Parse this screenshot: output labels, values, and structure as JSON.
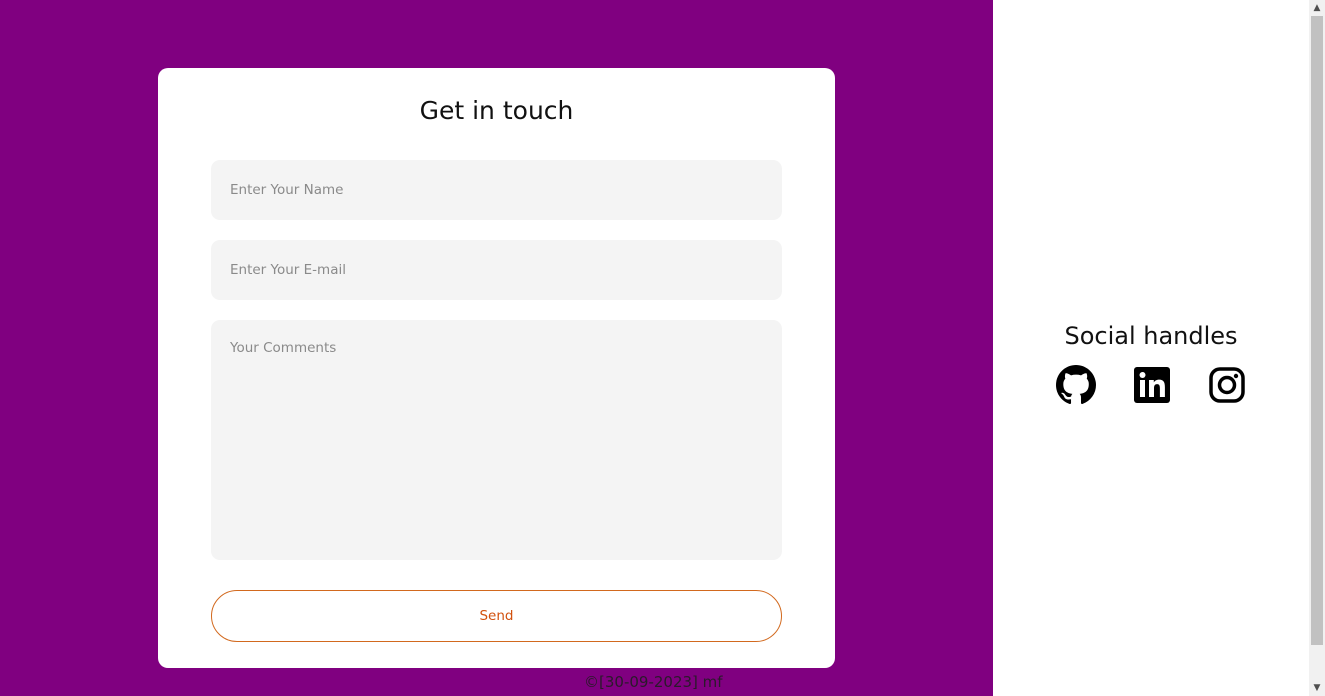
{
  "contact": {
    "title": "Get in touch",
    "name_placeholder": "Enter Your Name",
    "email_placeholder": "Enter Your E-mail",
    "comments_placeholder": "Your Comments",
    "send_label": "Send"
  },
  "footer": {
    "text": "©[30-09-2023] mf"
  },
  "social": {
    "title": "Social handles",
    "icons": [
      "github-icon",
      "linkedin-icon",
      "instagram-icon"
    ]
  },
  "colors": {
    "left_background": "#800080",
    "card_background": "#ffffff",
    "field_background": "#f4f4f4",
    "button_accent": "#d2510e",
    "right_background": "#ffffff"
  }
}
